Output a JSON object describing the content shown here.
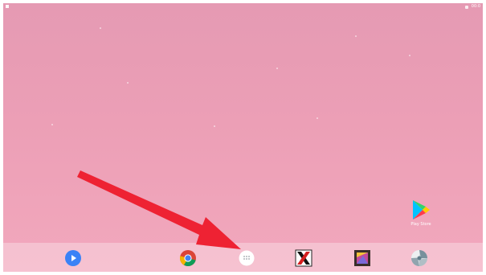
{
  "status_bar": {
    "time": "00:0"
  },
  "desktop": {
    "play_store": {
      "label": "Play Store",
      "icon": "play-store-icon"
    }
  },
  "dock": {
    "apps": [
      {
        "name": "video-player",
        "icon": "play-circle-icon",
        "color": "#3b82f6"
      },
      {
        "name": "chrome",
        "icon": "chrome-icon"
      },
      {
        "name": "app-drawer",
        "icon": "app-drawer-icon"
      },
      {
        "name": "x-app",
        "icon": "x-logo-icon"
      },
      {
        "name": "gallery",
        "icon": "gallery-icon"
      },
      {
        "name": "camera-aperture",
        "icon": "aperture-icon"
      }
    ]
  },
  "nav_bar": {
    "buttons": [
      "screenshot-icon",
      "back-icon",
      "home-icon",
      "recents-icon",
      "split-screen-icon",
      "keyboard-icon"
    ]
  },
  "colors": {
    "wallpaper_top": "#e59ab3",
    "wallpaper_bottom": "#f2a8bd",
    "arrow": "#ee2233"
  }
}
